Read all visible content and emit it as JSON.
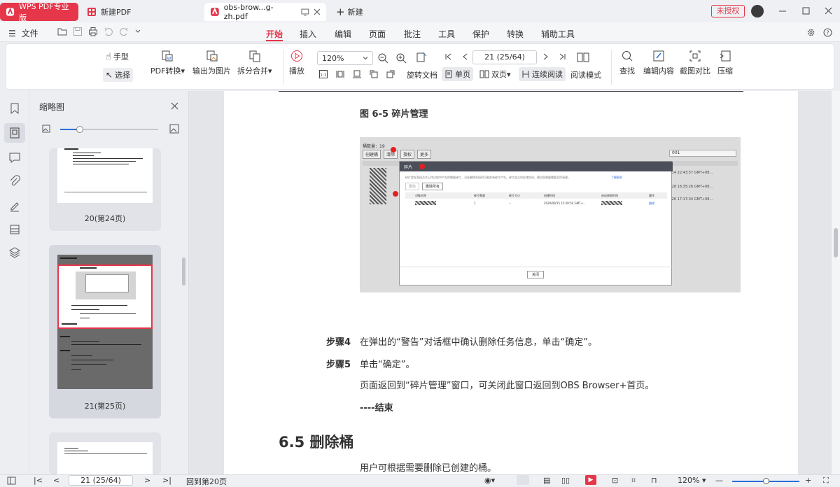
{
  "tabs": {
    "app": "WPS PDF专业版",
    "new_pdf": "新建PDF",
    "document": "obs-brow...g-zh.pdf",
    "add": "新建"
  },
  "window": {
    "license_badge": "未授权"
  },
  "menu": {
    "file": "文件",
    "items": [
      "开始",
      "插入",
      "编辑",
      "页面",
      "批注",
      "工具",
      "保护",
      "转换",
      "辅助工具"
    ],
    "active": "开始"
  },
  "ribbon": {
    "hand": "手型",
    "select": "选择",
    "pdf_convert": "PDF转换",
    "export_image": "输出为图片",
    "split_merge": "拆分合并",
    "play": "播放",
    "zoom": "120%",
    "page_input": "21 (25/64)",
    "rotate": "旋转文档",
    "single_page": "单页",
    "double_page": "双页",
    "continuous": "连续阅读",
    "reading_mode": "阅读模式",
    "find": "查找",
    "edit_content": "编辑内容",
    "screenshot_compare": "截图对比",
    "compress": "压缩"
  },
  "thumb_panel": {
    "title": "缩略图",
    "pages": [
      {
        "label": "20(第24页)"
      },
      {
        "label": "21(第25页)"
      }
    ],
    "zoom_level": 0.2
  },
  "document": {
    "figure_caption": "图 6-5 碎片管理",
    "screenshot": {
      "total": "桶数量：19",
      "create_bucket": "创建桶",
      "clear": "清除",
      "grant": "授权",
      "more": "更多",
      "search_value": "001",
      "dialog_title": "碎片",
      "dialog_note": "碎片是在多段方式上传过程中产生的数据碎片，当在删除多段时可能会有碎片产生。碎片会占用存储空间，建议您根据需要及时清理。",
      "learn_more": "了解更多",
      "delete_btn": "删除",
      "delete_all_btn": "删除所有",
      "columns": [
        "对象名称",
        "碎片数量",
        "碎片大小",
        "创建时间",
        "启动快照时间",
        "操作"
      ],
      "row": [
        "",
        "1",
        "--",
        "2020/09/15 15:20:54 GMT+...",
        "",
        "删除"
      ],
      "bucket_times": [
        "/14 22:43:57 GMT+08...",
        "/28 16:35:26 GMT+08...",
        "/26 17:17:34 GMT+08..."
      ],
      "close_btn": "关闭"
    },
    "steps": [
      {
        "label": "步骤4",
        "text": "在弹出的“警告”对话框中确认删除任务信息，单击“确定”。"
      },
      {
        "label": "步骤5",
        "text": "单击“确定”。"
      }
    ],
    "after_step": "页面返回到“碎片管理”窗口，可关闭此窗口返回到OBS Browser+首页。",
    "end_mark": "----结束",
    "section_title": "6.5 删除桶",
    "section_intro": "用户可根据需要删除已创建的桶。"
  },
  "status": {
    "page_input": "21 (25/64)",
    "goto_page": "回到第20页",
    "zoom": "120%"
  },
  "colors": {
    "accent": "#e5364a",
    "thumb_highlight": "#e5364a"
  }
}
